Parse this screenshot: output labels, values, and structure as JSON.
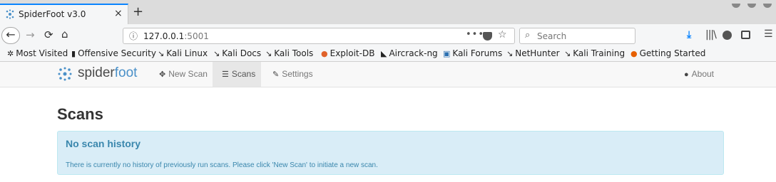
{
  "browser": {
    "tab": {
      "title": "SpiderFoot v3.0",
      "close": "×"
    },
    "new_tab": "+",
    "url": {
      "host": "127.0.0.1",
      "port": ":5001"
    },
    "url_more": "•••",
    "search_placeholder": "Search",
    "bookmarks": [
      {
        "label": "Most Visited",
        "icon": "gear-icon"
      },
      {
        "label": "Offensive Security",
        "icon": "offsec-icon"
      },
      {
        "label": "Kali Linux",
        "icon": "kali-icon"
      },
      {
        "label": "Kali Docs",
        "icon": "kali-icon"
      },
      {
        "label": "Kali Tools",
        "icon": "kali-icon"
      },
      {
        "label": "Exploit-DB",
        "icon": "exploitdb-icon"
      },
      {
        "label": "Aircrack-ng",
        "icon": "aircrack-icon"
      },
      {
        "label": "Kali Forums",
        "icon": "forums-icon"
      },
      {
        "label": "NetHunter",
        "icon": "kali-icon"
      },
      {
        "label": "Kali Training",
        "icon": "kali-icon"
      },
      {
        "label": "Getting Started",
        "icon": "firefox-icon"
      }
    ]
  },
  "app": {
    "brand_part1": "spider",
    "brand_part2": "foot",
    "nav": {
      "new_scan": "New Scan",
      "scans": "Scans",
      "settings": "Settings",
      "about": "About"
    },
    "accent": "#4a90c8"
  },
  "main": {
    "title": "Scans",
    "alert": {
      "title": "No scan history",
      "text": "There is currently no history of previously run scans. Please click 'New Scan' to initiate a new scan."
    }
  }
}
